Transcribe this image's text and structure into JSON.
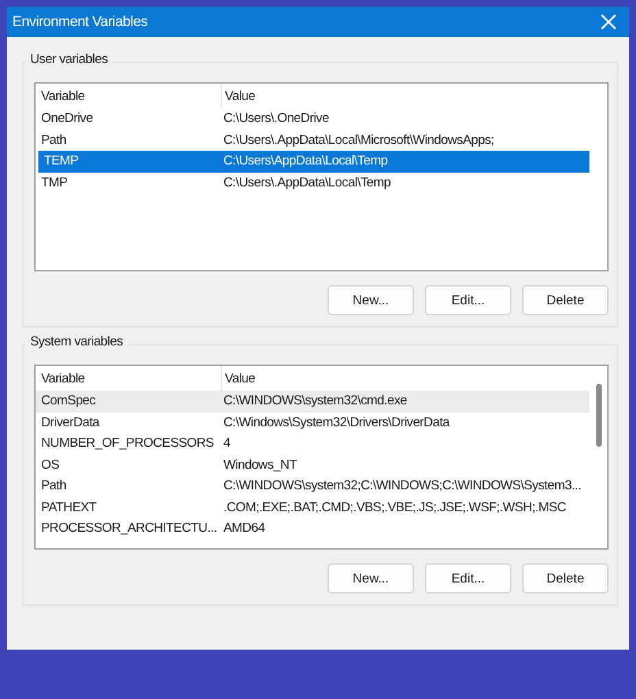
{
  "window": {
    "title": "Environment Variables"
  },
  "groups": [
    {
      "title": "User variables",
      "focused": true,
      "scrollbar": false,
      "columns": [
        "Variable",
        "Value"
      ],
      "rows": [
        {
          "cells": [
            "OneDrive",
            "C:\\Users\\.OneDrive"
          ],
          "selected": false
        },
        {
          "cells": [
            "Path",
            "C:\\Users\\.AppData\\Local\\Microsoft\\WindowsApps;"
          ],
          "selected": false
        },
        {
          "cells": [
            "TEMP",
            "C:\\Users\\AppData\\Local\\Temp"
          ],
          "selected": true
        },
        {
          "cells": [
            "TMP",
            "C:\\Users\\.AppData\\Local\\Temp"
          ],
          "selected": false
        }
      ],
      "buttons": [
        "New...",
        "Edit...",
        "Delete"
      ]
    },
    {
      "title": "System variables",
      "focused": false,
      "scrollbar": true,
      "columns": [
        "Variable",
        "Value"
      ],
      "rows": [
        {
          "cells": [
            "ComSpec",
            "C:\\WINDOWS\\system32\\cmd.exe"
          ],
          "selected": true
        },
        {
          "cells": [
            "DriverData",
            "C:\\Windows\\System32\\Drivers\\DriverData"
          ],
          "selected": false
        },
        {
          "cells": [
            "NUMBER_OF_PROCESSORS",
            "4"
          ],
          "selected": false
        },
        {
          "cells": [
            "OS",
            "Windows_NT"
          ],
          "selected": false
        },
        {
          "cells": [
            "Path",
            "C:\\WINDOWS\\system32;C:\\WINDOWS;C:\\WINDOWS\\System3..."
          ],
          "selected": false
        },
        {
          "cells": [
            "PATHEXT",
            ".COM;.EXE;.BAT;.CMD;.VBS;.VBE;.JS;.JSE;.WSF;.WSH;.MSC"
          ],
          "selected": false
        },
        {
          "cells": [
            "PROCESSOR_ARCHITECTU...",
            "AMD64"
          ],
          "selected": false
        }
      ],
      "buttons": [
        "New...",
        "Edit...",
        "Delete"
      ]
    }
  ]
}
